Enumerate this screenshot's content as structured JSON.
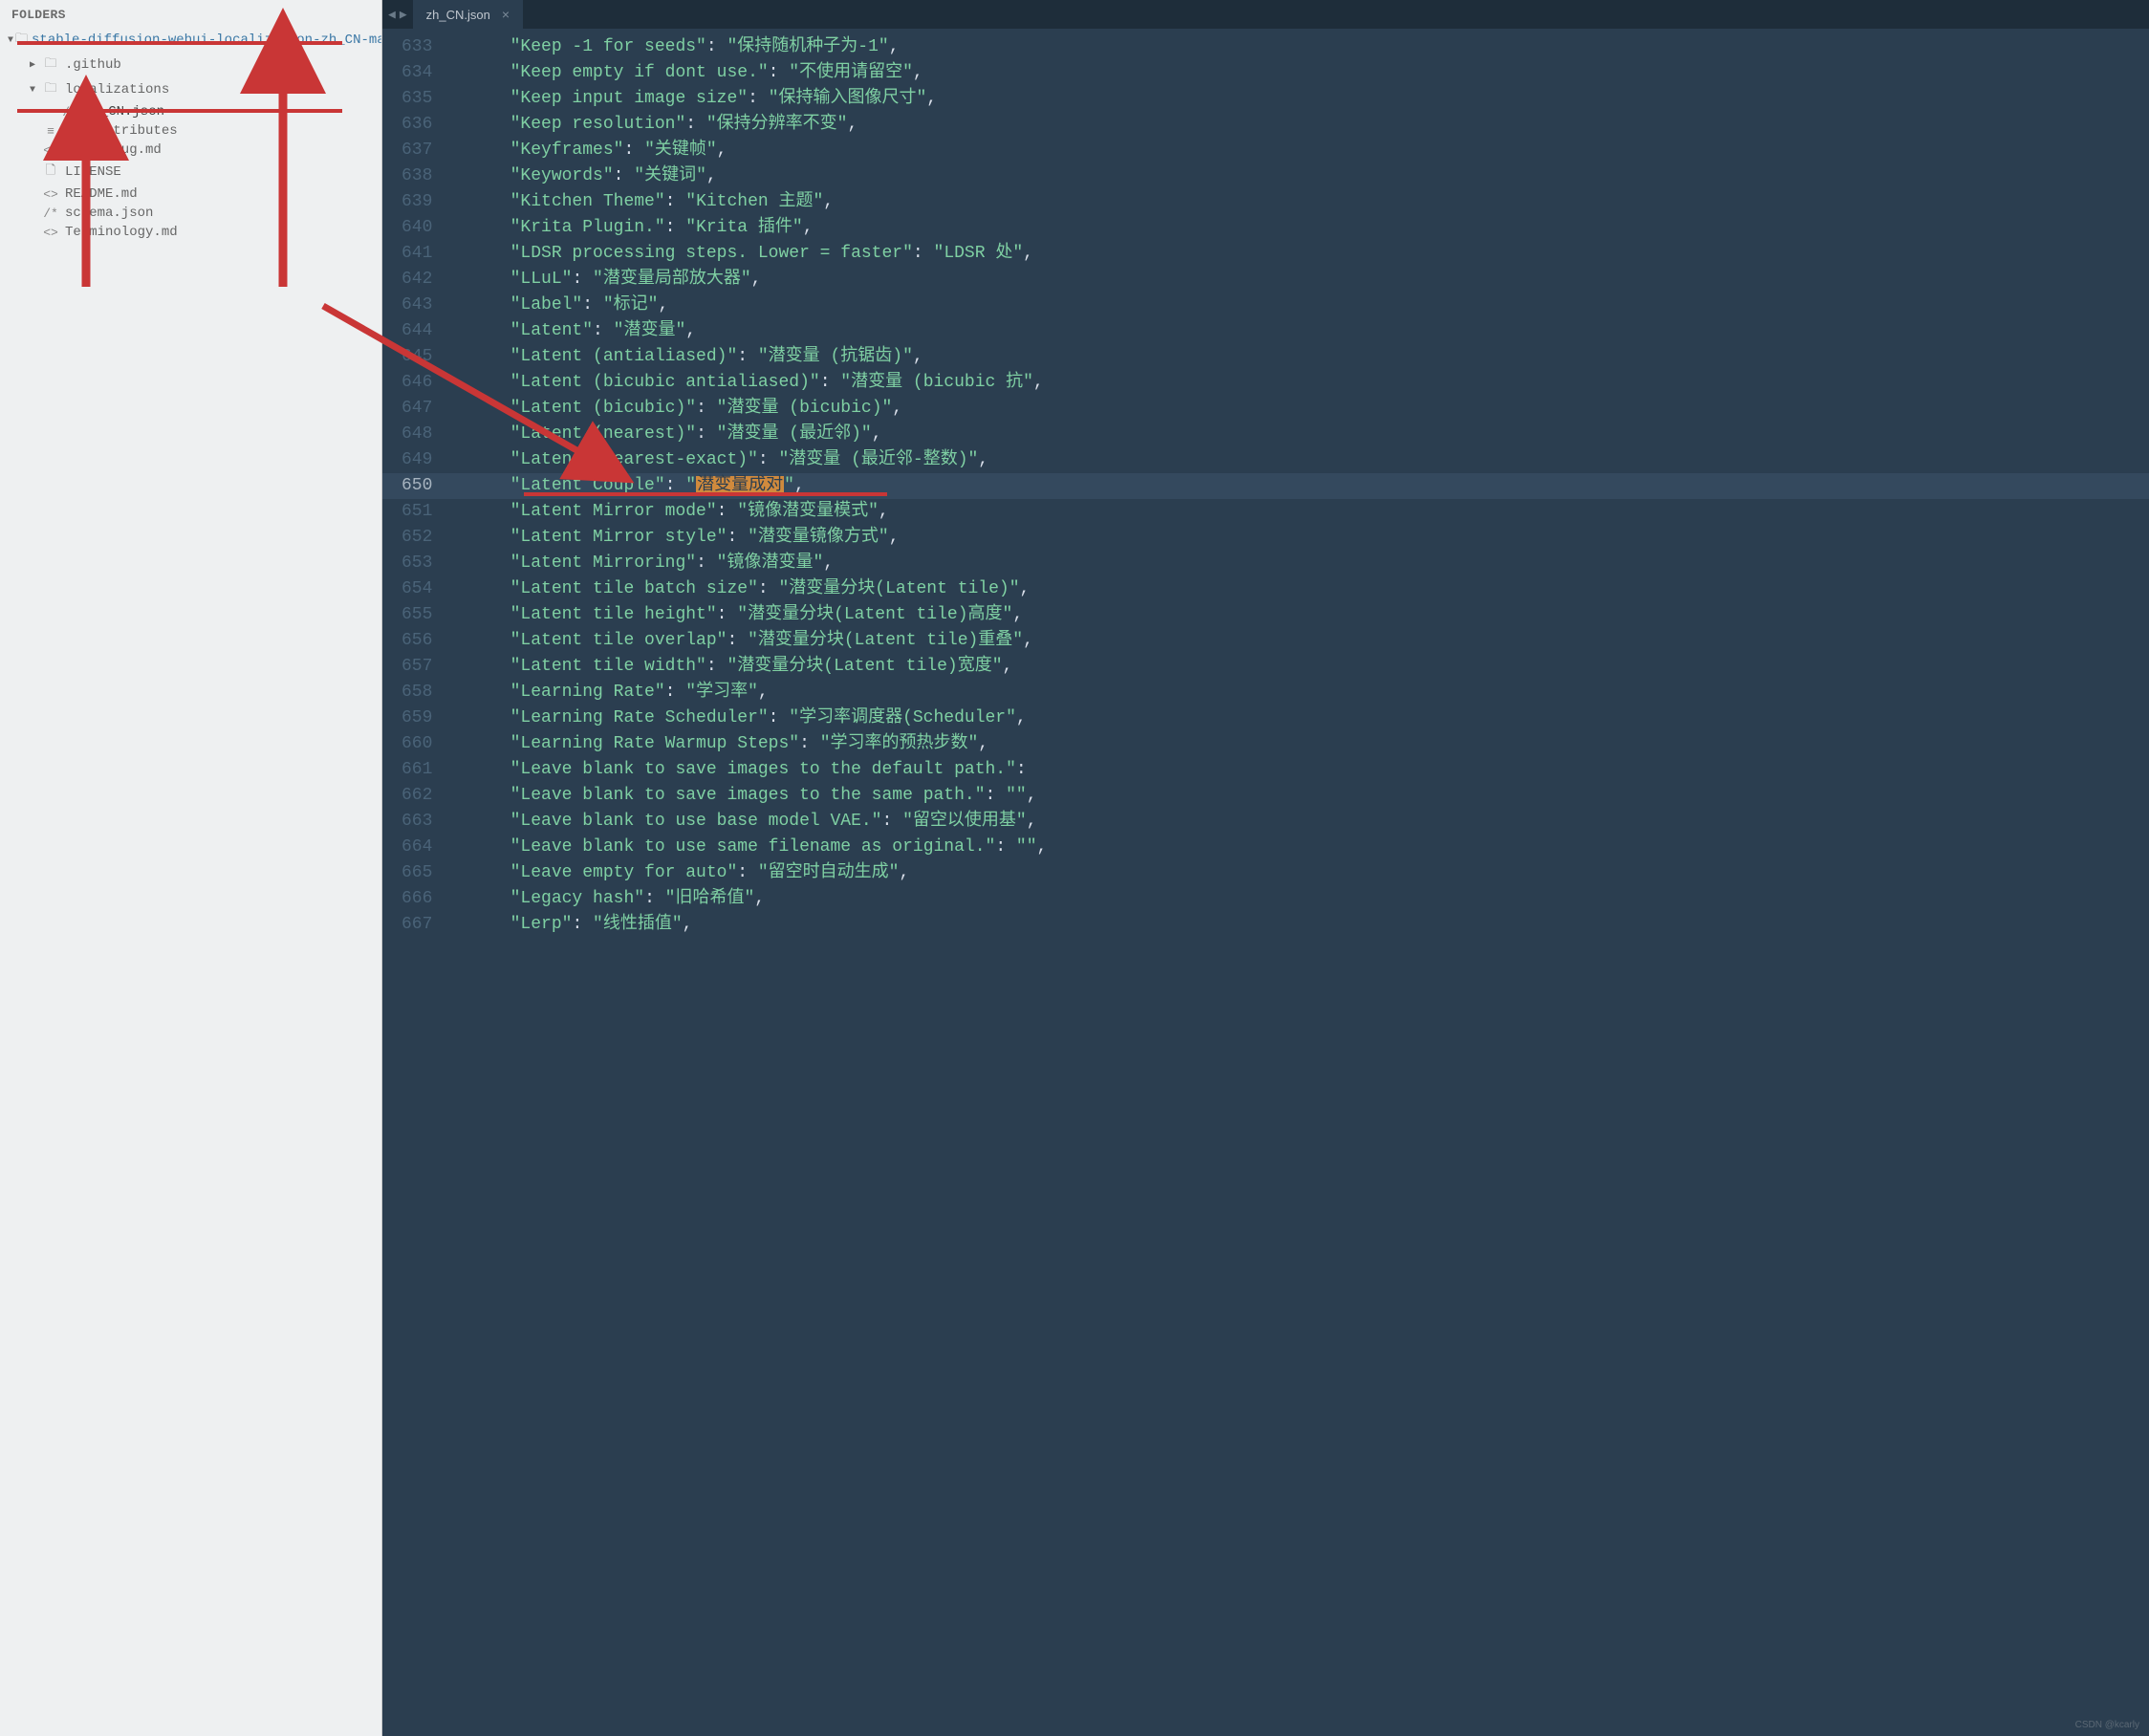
{
  "sidebar": {
    "header": "FOLDERS",
    "root": {
      "label": "stable-diffusion-webui-localization-zh_CN-main",
      "children": [
        {
          "label": ".github",
          "type": "folder",
          "icon": "folder",
          "expanded": false
        },
        {
          "label": "localizations",
          "type": "folder",
          "icon": "folder",
          "expanded": true,
          "children": [
            {
              "label": "zh_CN.json",
              "type": "file",
              "icon": "comment"
            }
          ]
        },
        {
          "label": ".gitattributes",
          "type": "file",
          "icon": "lines"
        },
        {
          "label": "Known-Bug.md",
          "type": "file",
          "icon": "code"
        },
        {
          "label": "LICENSE",
          "type": "file",
          "icon": "doc"
        },
        {
          "label": "README.md",
          "type": "file",
          "icon": "code"
        },
        {
          "label": "schema.json",
          "type": "file",
          "icon": "comment"
        },
        {
          "label": "Terminology.md",
          "type": "file",
          "icon": "code"
        }
      ]
    }
  },
  "tab": {
    "title": "zh_CN.json",
    "close": "×"
  },
  "gutter_start": 633,
  "gutter_end": 667,
  "active_line": 650,
  "lines": [
    {
      "key": "Keep -1 for seeds",
      "value": "保持随机种子为-1"
    },
    {
      "key": "Keep empty if dont use.",
      "value": "不使用请留空"
    },
    {
      "key": "Keep input image size",
      "value": "保持输入图像尺寸"
    },
    {
      "key": "Keep resolution",
      "value": "保持分辨率不变"
    },
    {
      "key": "Keyframes",
      "value": "关键帧"
    },
    {
      "key": "Keywords",
      "value": "关键词"
    },
    {
      "key": "Kitchen Theme",
      "value": "Kitchen 主题"
    },
    {
      "key": "Krita Plugin.",
      "value": "Krita 插件"
    },
    {
      "key": "LDSR processing steps. Lower = faster",
      "value": "LDSR 处"
    },
    {
      "key": "LLuL",
      "value": "潜变量局部放大器"
    },
    {
      "key": "Label",
      "value": "标记"
    },
    {
      "key": "Latent",
      "value": "潜变量"
    },
    {
      "key": "Latent (antialiased)",
      "value": "潜变量 (抗锯齿)"
    },
    {
      "key": "Latent (bicubic antialiased)",
      "value": "潜变量 (bicubic 抗"
    },
    {
      "key": "Latent (bicubic)",
      "value": "潜变量 (bicubic)"
    },
    {
      "key": "Latent (nearest)",
      "value": "潜变量 (最近邻)"
    },
    {
      "key": "Latent (nearest-exact)",
      "value": "潜变量 (最近邻-整数)"
    },
    {
      "key": "Latent Couple",
      "value": "潜变量成对",
      "highlighted": true
    },
    {
      "key": "Latent Mirror mode",
      "value": "镜像潜变量模式"
    },
    {
      "key": "Latent Mirror style",
      "value": "潜变量镜像方式"
    },
    {
      "key": "Latent Mirroring",
      "value": "镜像潜变量"
    },
    {
      "key": "Latent tile batch size",
      "value": "潜变量分块(Latent tile)"
    },
    {
      "key": "Latent tile height",
      "value": "潜变量分块(Latent tile)高度"
    },
    {
      "key": "Latent tile overlap",
      "value": "潜变量分块(Latent tile)重叠"
    },
    {
      "key": "Latent tile width",
      "value": "潜变量分块(Latent tile)宽度"
    },
    {
      "key": "Learning Rate",
      "value": "学习率"
    },
    {
      "key": "Learning Rate Scheduler",
      "value": "学习率调度器(Scheduler"
    },
    {
      "key": "Learning Rate Warmup Steps",
      "value": "学习率的预热步数"
    },
    {
      "key": "Leave blank to save images to the default path."
    },
    {
      "key": "Leave blank to save images to the same path.",
      "value": ""
    },
    {
      "key": "Leave blank to use base model VAE.",
      "value": "留空以使用基"
    },
    {
      "key": "Leave blank to use same filename as original.",
      "value": ""
    },
    {
      "key": "Leave empty for auto",
      "value": "留空时自动生成"
    },
    {
      "key": "Legacy hash",
      "value": "旧哈希值"
    },
    {
      "key": "Lerp",
      "value": "线性插值"
    }
  ],
  "watermark": "CSDN @kcarly"
}
